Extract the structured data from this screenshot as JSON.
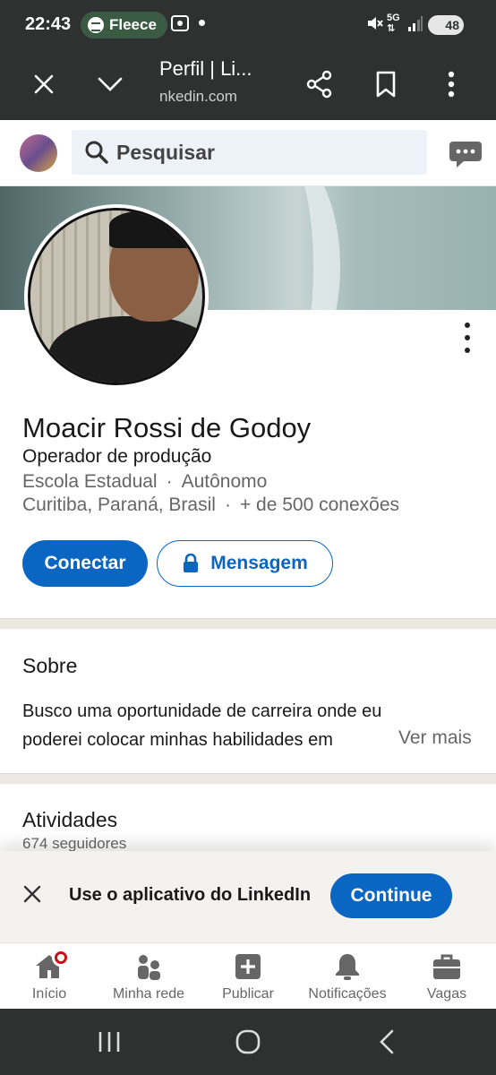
{
  "status_bar": {
    "time": "22:43",
    "media_app": "Fleece",
    "battery": "48",
    "network": "5G"
  },
  "browser": {
    "title": "Perfil | Li...",
    "url": "nkedin.com"
  },
  "search": {
    "placeholder": "Pesquisar"
  },
  "profile": {
    "name": "Moacir Rossi de Godoy",
    "headline": "Operador de produção",
    "school": "Escola Estadual",
    "company": "Autônomo",
    "location": "Curitiba, Paraná, Brasil",
    "connections": "+ de 500 conexões",
    "separator": "·"
  },
  "actions": {
    "connect": "Conectar",
    "message": "Mensagem"
  },
  "about": {
    "title": "Sobre",
    "text": "Busco uma oportunidade de carreira onde eu poderei colocar minhas habilidades em prática",
    "see_more": "Ver mais"
  },
  "activity": {
    "title": "Atividades",
    "followers": "674 seguidores"
  },
  "app_banner": {
    "text": "Use o aplicativo do LinkedIn",
    "button": "Continue"
  },
  "tabs": [
    {
      "label": "Início",
      "icon": "home-icon"
    },
    {
      "label": "Minha rede",
      "icon": "network-icon"
    },
    {
      "label": "Publicar",
      "icon": "post-icon"
    },
    {
      "label": "Notificações",
      "icon": "bell-icon"
    },
    {
      "label": "Vagas",
      "icon": "briefcase-icon"
    }
  ],
  "colors": {
    "accent": "#0a66c2",
    "system_bar": "#2f3131",
    "notification_badge": "#cc1016"
  }
}
